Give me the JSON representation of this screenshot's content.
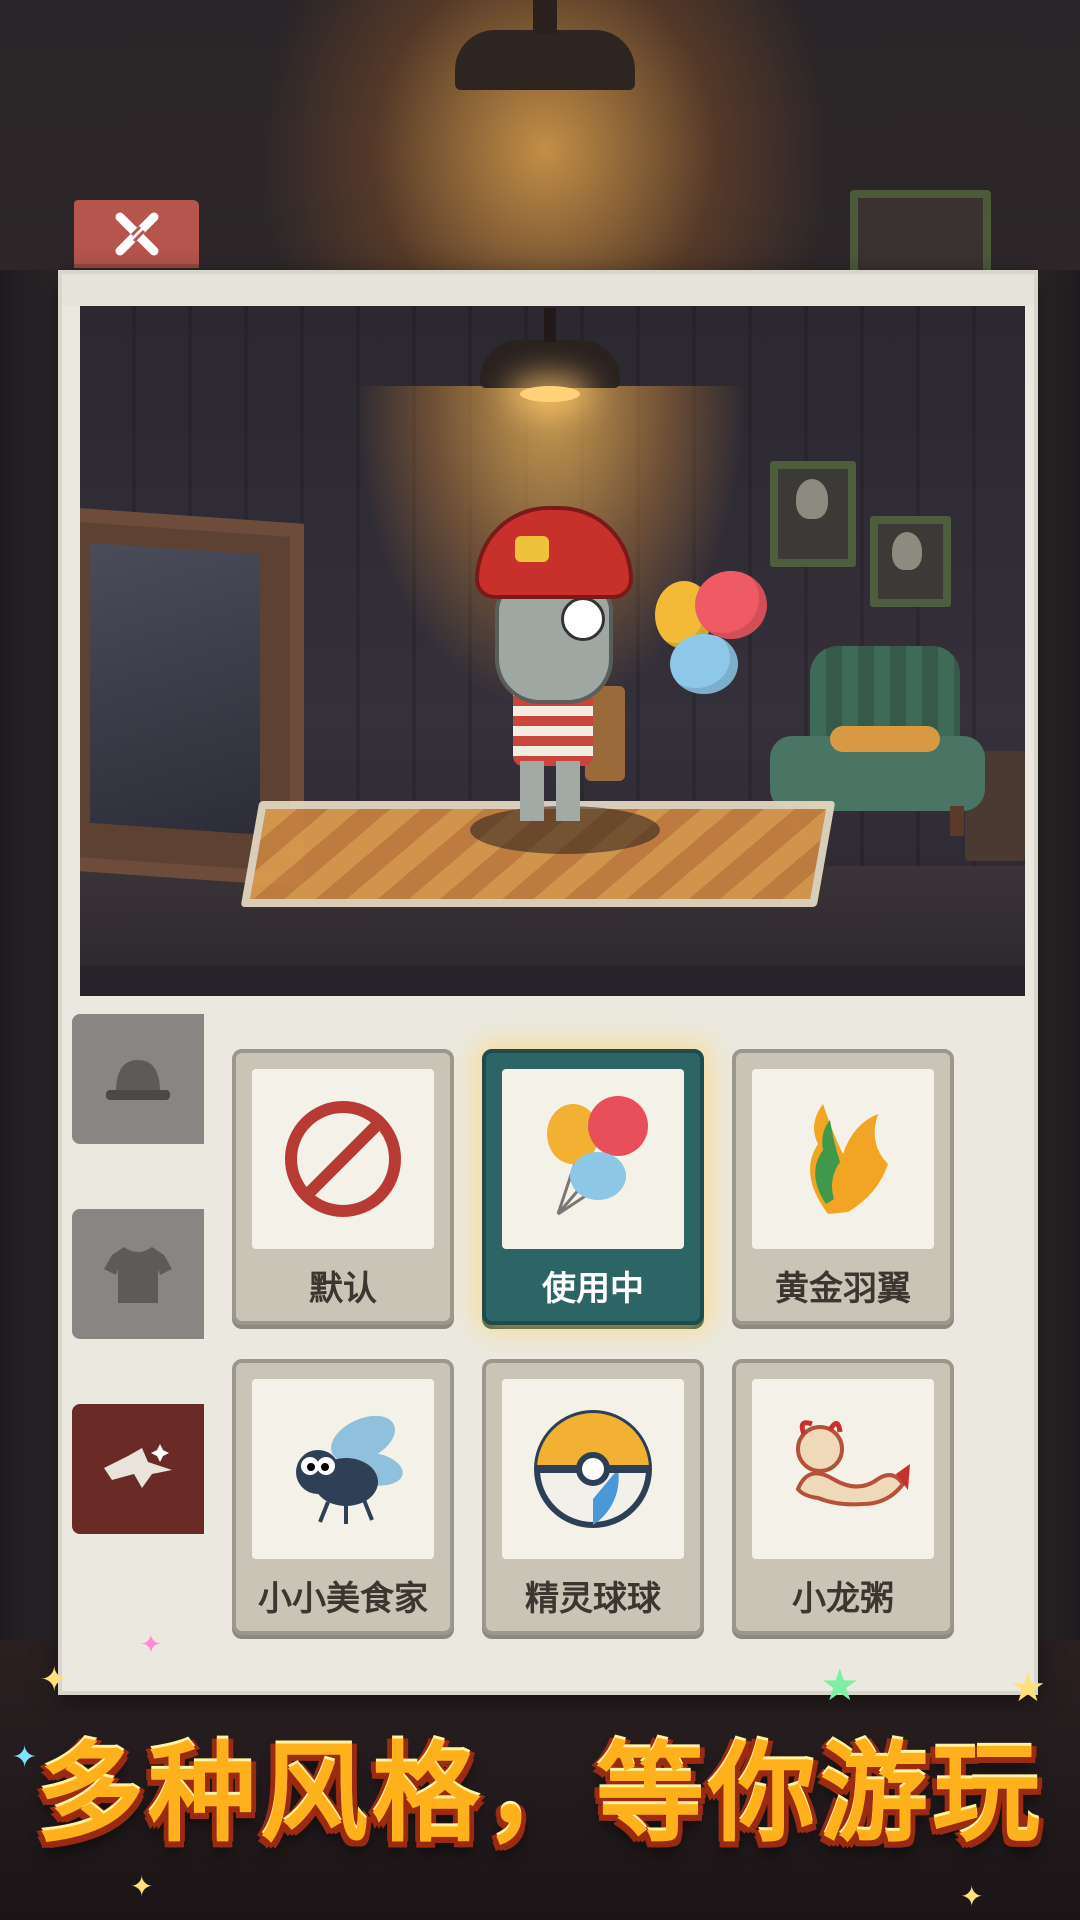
{
  "close_button": {
    "icon": "close-icon"
  },
  "scene": {
    "description_icons": [
      "ceiling-lamp-icon",
      "mirror-icon",
      "armchair-icon",
      "portrait-icon",
      "balloon-icon"
    ]
  },
  "category_tabs": [
    {
      "icon": "hat-icon",
      "state": "inactive"
    },
    {
      "icon": "shirt-icon",
      "state": "inactive"
    },
    {
      "icon": "wings-icon",
      "state": "active"
    }
  ],
  "items": [
    {
      "label": "默认",
      "icon": "none-icon",
      "selected": false
    },
    {
      "label": "使用中",
      "icon": "balloons-icon",
      "selected": true
    },
    {
      "label": "黄金羽翼",
      "icon": "golden-wings-icon",
      "selected": false
    },
    {
      "label": "小小美食家",
      "icon": "fly-icon",
      "selected": false
    },
    {
      "label": "精灵球球",
      "icon": "ball-icon",
      "selected": false
    },
    {
      "label": "小龙粥",
      "icon": "dragon-icon",
      "selected": false
    }
  ],
  "banner": {
    "text": "多种风格，等你游玩"
  },
  "colors": {
    "panel": "#ebe9df",
    "close_tab": "#b5554d",
    "selected_card": "#2d6466",
    "active_tab": "#6a2a26",
    "banner_text": "#ffb11c"
  }
}
